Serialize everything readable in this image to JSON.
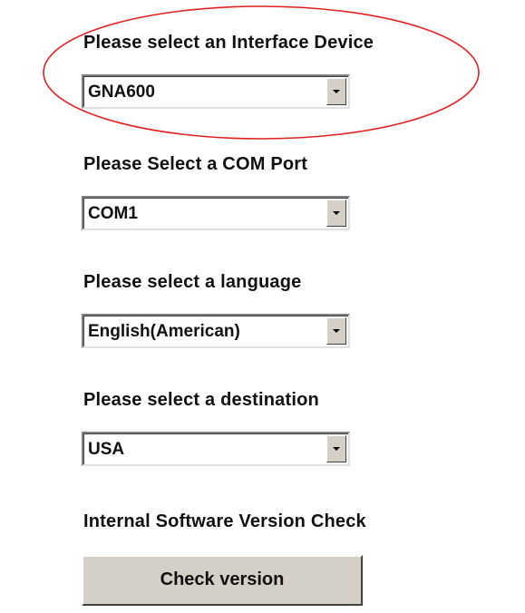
{
  "interface_device": {
    "label": "Please select an Interface Device",
    "value": "GNA600"
  },
  "com_port": {
    "label": "Please Select a COM Port",
    "value": "COM1"
  },
  "language": {
    "label": "Please select a language",
    "value": "English(American)"
  },
  "destination": {
    "label": "Please select a destination",
    "value": "USA"
  },
  "version_check": {
    "label": "Internal Software Version Check",
    "button_label": "Check version"
  },
  "annotation": {
    "color": "#e02020",
    "shape": "ellipse"
  }
}
